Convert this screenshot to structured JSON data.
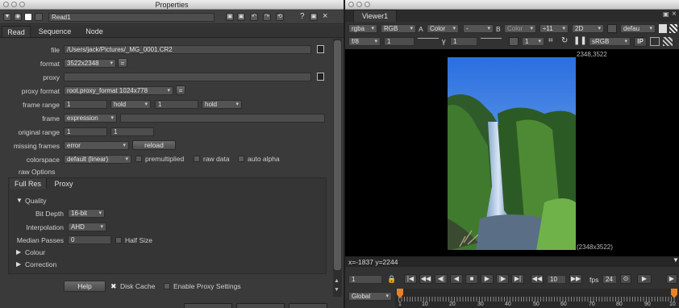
{
  "properties": {
    "window_title": "Properties",
    "node_name": "Read1",
    "tabs": [
      "Read",
      "Sequence",
      "Node"
    ],
    "labels": {
      "file": "file",
      "format": "format",
      "proxy": "proxy",
      "proxy_format": "proxy format",
      "frame_range": "frame range",
      "frame": "frame",
      "original_range": "original range",
      "missing_frames": "missing frames",
      "colorspace": "colorspace",
      "raw_options": "raw Options"
    },
    "file_value": "/Users/jack/Pictures/_MG_0001.CR2",
    "format_value": "3522x2348",
    "proxy_value": "",
    "proxy_format_value": "root.proxy_format 1024x778",
    "frame_range_start": "1",
    "frame_range_start_mode": "hold",
    "frame_range_end": "1",
    "frame_range_end_mode": "hold",
    "frame_mode": "expression",
    "frame_expr": "",
    "original_range_start": "1",
    "original_range_end": "1",
    "missing_frames_value": "error",
    "reload_label": "reload",
    "colorspace_value": "default (linear)",
    "premultiplied_label": "premultiplied",
    "raw_data_label": "raw data",
    "auto_alpha_label": "auto alpha",
    "inner_tabs": [
      "Full Res",
      "Proxy"
    ],
    "quality_label": "Quality",
    "bit_depth_label": "Bit Depth",
    "bit_depth_value": "16-bit",
    "interpolation_label": "Interpolation",
    "interpolation_value": "AHD",
    "median_passes_label": "Median Passes",
    "median_passes_value": "0",
    "half_size_label": "Half Size",
    "colour_label": "Colour",
    "correction_label": "Correction",
    "help_label": "Help",
    "disk_cache_label": "Disk Cache",
    "enable_proxy_label": "Enable Proxy Settings"
  },
  "viewer": {
    "tab_label": "Viewer1",
    "channels": "rgba",
    "layer": "RGB",
    "a_label": "A",
    "a_input": "Color",
    "a_dash": "-",
    "b_label": "B",
    "b_input": "Color",
    "zoom": "÷11",
    "mode": "2D",
    "lut_default": "defau",
    "fstop": "f/8",
    "gain": "1",
    "gamma_label": "γ",
    "gamma": "1",
    "proxy_scale": "1",
    "colorspace": "sRGB",
    "ip_label": "IP",
    "res_top": "2348,3522",
    "res_bottom": "(2348x3522)",
    "coords": "x=-1837 y=2244",
    "frame": "1",
    "step": "10",
    "fps_label": "fps",
    "fps": "24",
    "global_label": "Global",
    "timeline_ticks": [
      "1",
      "10",
      "20",
      "30",
      "40",
      "50",
      "60",
      "70",
      "80",
      "90",
      "10"
    ]
  }
}
